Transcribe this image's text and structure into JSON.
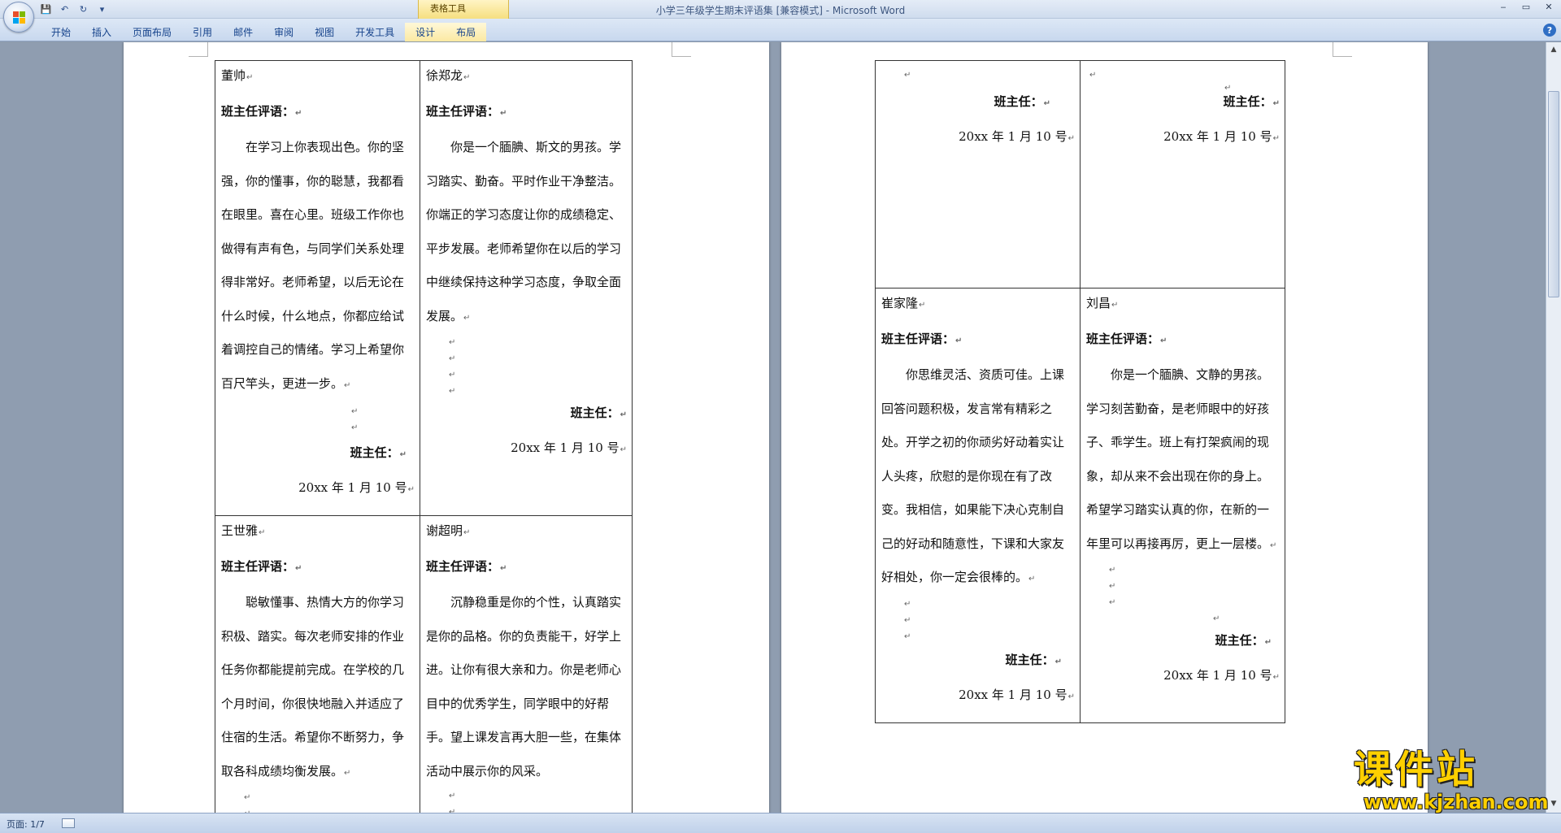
{
  "window": {
    "title": "小学三年级学生期末评语集 [兼容模式] - Microsoft Word",
    "context_tab_group": "表格工具",
    "controls": [
      "‒",
      "▭",
      "✕"
    ]
  },
  "quick_access": {
    "icons": [
      "save-icon",
      "undo-icon",
      "redo-icon",
      "customize-icon"
    ],
    "glyphs": [
      "💾",
      "↶",
      "↻",
      "▾"
    ]
  },
  "ribbon": {
    "tabs": [
      {
        "label": "开始"
      },
      {
        "label": "插入"
      },
      {
        "label": "页面布局"
      },
      {
        "label": "引用"
      },
      {
        "label": "邮件"
      },
      {
        "label": "审阅"
      },
      {
        "label": "视图"
      },
      {
        "label": "开发工具"
      },
      {
        "label": "设计"
      },
      {
        "label": "布局"
      }
    ],
    "help": "?"
  },
  "paragraph_mark": "↵",
  "left_page": {
    "row1": [
      {
        "name": "董帅",
        "label": "班主任评语：",
        "text": "在学习上你表现出色。你的坚强，你的懂事，你的聪慧，我都看在眼里。喜在心里。班级工作你也做得有声有色，与同学们关系处理得非常好。老师希望，以后无论在什么时候，什么地点，你都应给试着调控自己的情绪。学习上希望你百尺竿头，更进一步。",
        "signature": "班主任：",
        "date": "20xx 年 1 月 10 号"
      },
      {
        "name": "徐郑龙",
        "label": "班主任评语：",
        "text": "你是一个腼腆、斯文的男孩。学习踏实、勤奋。平时作业干净整洁。你端正的学习态度让你的成绩稳定、平步发展。老师希望你在以后的学习中继续保持这种学习态度，争取全面发展。",
        "signature": "班主任：",
        "date": "20xx 年 1 月 10 号"
      }
    ],
    "row2": [
      {
        "name": "王世雅",
        "label": "班主任评语：",
        "text": "聪敏懂事、热情大方的你学习积极、踏实。每次老师安排的作业任务你都能提前完成。在学校的几个月时间，你很快地融入并适应了住宿的生活。希望你不断努力，争取各科成绩均衡发展。"
      },
      {
        "name": "谢超明",
        "label": "班主任评语：",
        "text": "沉静稳重是你的个性，认真踏实是你的品格。你的负责能干，好学上进。让你有很大亲和力。你是老师心目中的优秀学生，同学眼中的好帮手。望上课发言再大胆一些，在集体活动中展示你的风采。"
      }
    ]
  },
  "right_page": {
    "row1": [
      {
        "signature": "班主任：",
        "date": "20xx 年 1 月 10 号"
      },
      {
        "signature": "班主任：",
        "date": "20xx 年 1 月 10 号"
      }
    ],
    "row2": [
      {
        "name": "崔家隆",
        "label": "班主任评语：",
        "text": "你思维灵活、资质可佳。上课回答问题积极，发言常有精彩之处。开学之初的你顽劣好动着实让人头疼，欣慰的是你现在有了改变。我相信，如果能下决心克制自己的好动和随意性，下课和大家友好相处，你一定会很棒的。",
        "signature": "班主任：",
        "date": "20xx 年 1 月 10 号"
      },
      {
        "name": "刘昌",
        "label": "班主任评语：",
        "text": "你是一个腼腆、文静的男孩。学习刻苦勤奋，是老师眼中的好孩子、乖学生。班上有打架疯闹的现象，却从来不会出现在你的身上。希望学习踏实认真的你，在新的一年里可以再接再厉，更上一层楼。",
        "signature": "班主任：",
        "date": "20xx 年 1 月 10 号"
      }
    ]
  },
  "status_bar": {
    "page": "页面: 1/7"
  },
  "watermark": {
    "text": "课件站",
    "url": "www.kjzhan.com"
  },
  "colors": {
    "ribbon_text": "#15428b",
    "watermark": "#ffd000",
    "context_tab": "#f6df80"
  }
}
